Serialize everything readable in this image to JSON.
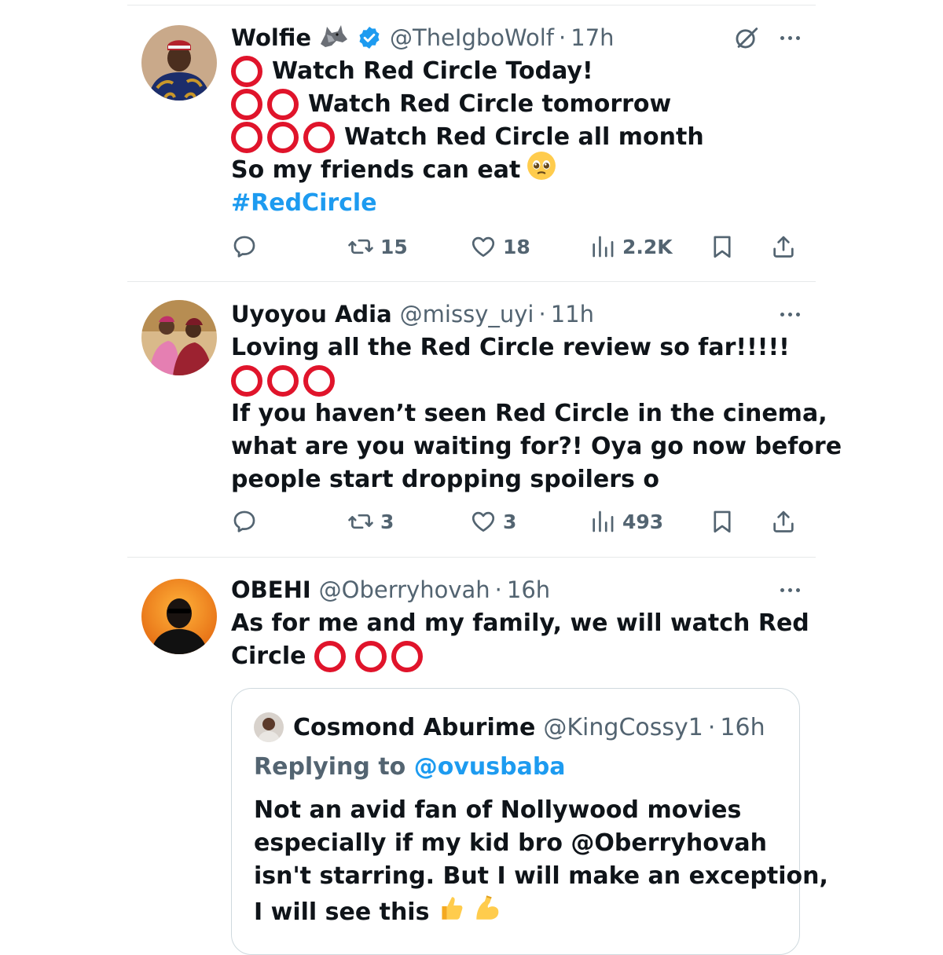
{
  "tweets": [
    {
      "name": "Wolfie",
      "name_emoji": "wolf-emoji",
      "verified": true,
      "handle": "@TheIgboWolf",
      "separator": "·",
      "time": "17h",
      "lines": [
        {
          "rings": 1,
          "text": "Watch Red Circle Today!"
        },
        {
          "rings": 2,
          "text": "Watch Red Circle tomorrow"
        },
        {
          "rings": 3,
          "text": "Watch Red Circle all month"
        },
        {
          "rings": 0,
          "text": "So my friends can eat"
        }
      ],
      "hashtag": "#RedCircle",
      "stats": {
        "retweets": "15",
        "likes": "18",
        "views": "2.2K"
      }
    },
    {
      "name": "Uyoyou Adia",
      "handle": "@missy_uyi",
      "separator": "·",
      "time": "11h",
      "lines": [
        {
          "rings": 0,
          "text": "Loving all the Red Circle review so far!!!!!"
        },
        {
          "rings": 3,
          "text": ""
        },
        {
          "rings": 0,
          "text": "If you haven’t seen Red Circle in the cinema,"
        },
        {
          "rings": 0,
          "text": "what are you waiting for?! Oya go now before"
        },
        {
          "rings": 0,
          "text": "people start dropping spoilers o"
        }
      ],
      "stats": {
        "retweets": "3",
        "likes": "3",
        "views": "493"
      }
    },
    {
      "name": "OBEHI",
      "handle": "@Oberryhovah",
      "separator": "·",
      "time": "16h",
      "lines": [
        {
          "rings": 0,
          "text": "As for me and my family, we will watch Red"
        },
        {
          "rings": 3,
          "text": "Circle"
        }
      ],
      "quote": {
        "name": "Cosmond Aburime",
        "handle": "@KingCossy1",
        "separator": "·",
        "time": "16h",
        "replying_label": "Replying to",
        "replying_to": "@ovusbaba",
        "lines": [
          "Not an avid fan of Nollywood movies",
          "especially if my kid bro @Oberryhovah",
          "isn't starring. But I will make an exception,",
          "I will see this"
        ]
      }
    }
  ],
  "colors": {
    "accent": "#1d9bf0",
    "ring": "#e0142b",
    "muted": "#536471",
    "text": "#0f1419"
  },
  "icons": [
    "reply-icon",
    "retweet-icon",
    "like-icon",
    "views-icon",
    "bookmark-icon",
    "share-icon",
    "more-icon",
    "grok-icon",
    "verified-badge-icon"
  ]
}
